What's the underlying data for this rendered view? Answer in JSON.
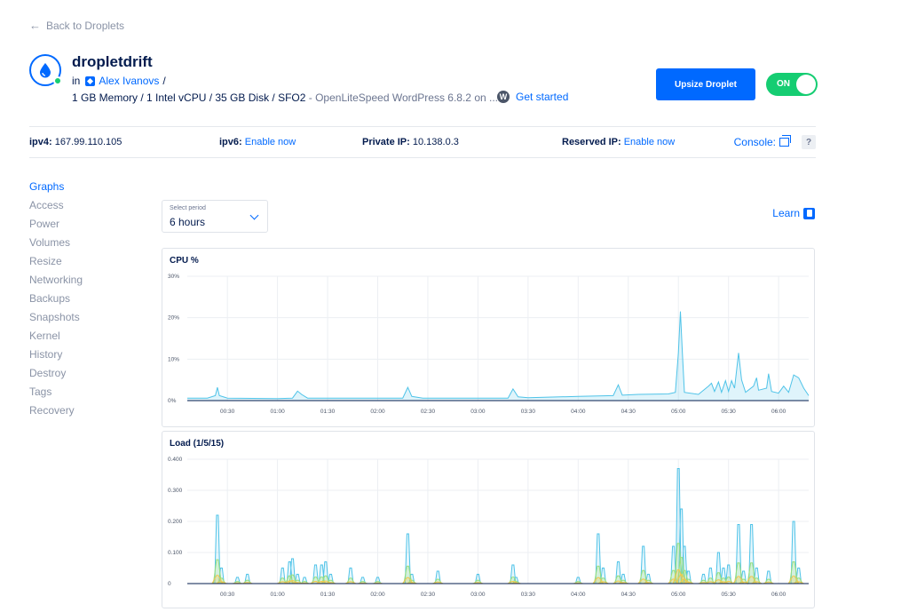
{
  "back_link": "Back to Droplets",
  "droplet": {
    "name": "dropletdrift",
    "owner_prefix": "in",
    "owner": "Alex Ivanovs",
    "owner_suffix": "/",
    "specs": "1 GB Memory / 1 Intel vCPU / 35 GB Disk / SFO2",
    "specs_muted": "- OpenLiteSpeed WordPress 6.8.2 on ...",
    "get_started": "Get started"
  },
  "actions": {
    "upsize_label": "Upsize Droplet",
    "power_label": "ON"
  },
  "network": {
    "ipv4_label": "ipv4:",
    "ipv4_value": "167.99.110.105",
    "ipv6_label": "ipv6:",
    "ipv6_link": "Enable now",
    "private_label": "Private IP:",
    "private_value": "10.138.0.3",
    "reserved_label": "Reserved IP:",
    "reserved_link": "Enable now",
    "console_label": "Console:",
    "help_label": "?"
  },
  "sidebar": {
    "items": [
      {
        "label": "Graphs",
        "active": true
      },
      {
        "label": "Access",
        "active": false
      },
      {
        "label": "Power",
        "active": false
      },
      {
        "label": "Volumes",
        "active": false
      },
      {
        "label": "Resize",
        "active": false
      },
      {
        "label": "Networking",
        "active": false
      },
      {
        "label": "Backups",
        "active": false
      },
      {
        "label": "Snapshots",
        "active": false
      },
      {
        "label": "Kernel",
        "active": false
      },
      {
        "label": "History",
        "active": false
      },
      {
        "label": "Destroy",
        "active": false
      },
      {
        "label": "Tags",
        "active": false
      },
      {
        "label": "Recovery",
        "active": false
      }
    ]
  },
  "period": {
    "caption": "Select period",
    "value": "6 hours"
  },
  "learn_label": "Learn",
  "colors": {
    "accent": "#0069ff",
    "on_green": "#15cd72",
    "cpu_line": "#4fc3e8",
    "load1": "#4fc3e8",
    "load5": "#9be07c",
    "load15": "#f2c94c"
  },
  "chart_data": [
    {
      "type": "line",
      "title": "CPU %",
      "x_ticks": [
        "00:30",
        "01:00",
        "01:30",
        "02:00",
        "02:30",
        "03:00",
        "03:30",
        "04:00",
        "04:30",
        "05:00",
        "05:30",
        "06:00"
      ],
      "y_ticks": [
        "0%",
        "10%",
        "20%",
        "30%"
      ],
      "ylim": [
        0,
        30
      ],
      "x_range": [
        0.1,
        6.3
      ],
      "series": [
        {
          "values": [
            [
              0.1,
              0.6
            ],
            [
              0.3,
              0.6
            ],
            [
              0.38,
              1.2
            ],
            [
              0.4,
              3.2
            ],
            [
              0.42,
              1.2
            ],
            [
              0.5,
              0.6
            ],
            [
              1.0,
              0.5
            ],
            [
              1.15,
              0.6
            ],
            [
              1.2,
              2.3
            ],
            [
              1.24,
              1.5
            ],
            [
              1.3,
              0.6
            ],
            [
              2.0,
              0.6
            ],
            [
              2.25,
              0.6
            ],
            [
              2.3,
              3.2
            ],
            [
              2.34,
              1.0
            ],
            [
              2.45,
              0.6
            ],
            [
              3.0,
              0.6
            ],
            [
              3.3,
              0.6
            ],
            [
              3.35,
              2.8
            ],
            [
              3.4,
              0.9
            ],
            [
              3.5,
              0.7
            ],
            [
              4.0,
              1.0
            ],
            [
              4.35,
              1.2
            ],
            [
              4.4,
              3.8
            ],
            [
              4.44,
              1.3
            ],
            [
              4.6,
              1.5
            ],
            [
              4.9,
              1.6
            ],
            [
              4.97,
              2.0
            ],
            [
              5.0,
              11.5
            ],
            [
              5.02,
              21.5
            ],
            [
              5.04,
              11.5
            ],
            [
              5.06,
              2.0
            ],
            [
              5.2,
              1.5
            ],
            [
              5.3,
              3.5
            ],
            [
              5.33,
              4.2
            ],
            [
              5.36,
              2.2
            ],
            [
              5.4,
              4.5
            ],
            [
              5.43,
              2.0
            ],
            [
              5.47,
              4.8
            ],
            [
              5.5,
              2.2
            ],
            [
              5.53,
              4.8
            ],
            [
              5.56,
              3.0
            ],
            [
              5.6,
              11.5
            ],
            [
              5.63,
              5.0
            ],
            [
              5.67,
              2.0
            ],
            [
              5.75,
              3.5
            ],
            [
              5.78,
              5.5
            ],
            [
              5.8,
              2.5
            ],
            [
              5.88,
              3.0
            ],
            [
              5.9,
              6.5
            ],
            [
              5.93,
              2.2
            ],
            [
              6.0,
              1.8
            ],
            [
              6.05,
              3.5
            ],
            [
              6.1,
              2.0
            ],
            [
              6.15,
              6.2
            ],
            [
              6.2,
              5.5
            ],
            [
              6.25,
              3.0
            ],
            [
              6.3,
              1.2
            ]
          ]
        }
      ]
    },
    {
      "type": "line",
      "title": "Load (1/5/15)",
      "x_ticks": [
        "00:30",
        "01:00",
        "01:30",
        "02:00",
        "02:30",
        "03:00",
        "03:30",
        "04:00",
        "04:30",
        "05:00",
        "05:30",
        "06:00"
      ],
      "y_ticks": [
        "0",
        "0.100",
        "0.200",
        "0.300",
        "0.400"
      ],
      "ylim": [
        0,
        0.4
      ],
      "x_range": [
        0.1,
        6.3
      ],
      "spikes": [
        [
          0.4,
          0.22
        ],
        [
          0.44,
          0.05
        ],
        [
          0.6,
          0.02
        ],
        [
          0.7,
          0.03
        ],
        [
          1.05,
          0.05
        ],
        [
          1.12,
          0.07
        ],
        [
          1.15,
          0.08
        ],
        [
          1.2,
          0.03
        ],
        [
          1.27,
          0.02
        ],
        [
          1.38,
          0.06
        ],
        [
          1.44,
          0.06
        ],
        [
          1.48,
          0.07
        ],
        [
          1.53,
          0.03
        ],
        [
          1.73,
          0.05
        ],
        [
          1.85,
          0.02
        ],
        [
          2.0,
          0.02
        ],
        [
          2.3,
          0.16
        ],
        [
          2.34,
          0.03
        ],
        [
          2.6,
          0.04
        ],
        [
          3.0,
          0.03
        ],
        [
          3.35,
          0.06
        ],
        [
          3.38,
          0.02
        ],
        [
          4.0,
          0.02
        ],
        [
          4.2,
          0.16
        ],
        [
          4.25,
          0.05
        ],
        [
          4.4,
          0.07
        ],
        [
          4.45,
          0.03
        ],
        [
          4.65,
          0.12
        ],
        [
          4.7,
          0.03
        ],
        [
          4.95,
          0.12
        ],
        [
          5.0,
          0.37
        ],
        [
          5.03,
          0.24
        ],
        [
          5.06,
          0.12
        ],
        [
          5.1,
          0.04
        ],
        [
          5.25,
          0.03
        ],
        [
          5.32,
          0.05
        ],
        [
          5.4,
          0.1
        ],
        [
          5.45,
          0.05
        ],
        [
          5.5,
          0.06
        ],
        [
          5.6,
          0.19
        ],
        [
          5.65,
          0.04
        ],
        [
          5.73,
          0.19
        ],
        [
          5.78,
          0.05
        ],
        [
          5.9,
          0.04
        ],
        [
          6.15,
          0.2
        ],
        [
          6.2,
          0.05
        ]
      ],
      "series_colors": [
        "load1",
        "load5",
        "load15"
      ]
    }
  ]
}
